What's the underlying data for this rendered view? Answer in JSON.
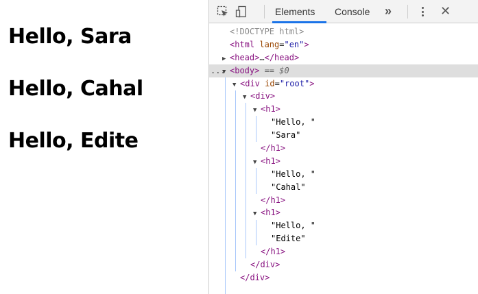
{
  "page": {
    "greetings": [
      "Hello, Sara",
      "Hello, Cahal",
      "Hello, Edite"
    ]
  },
  "devtools": {
    "tabs": [
      {
        "label": "Elements",
        "active": true
      },
      {
        "label": "Console",
        "active": false
      }
    ],
    "more_tabs_glyph": "»",
    "close_glyph": "✕",
    "icons": [
      "inspect-element-icon",
      "device-toolbar-icon",
      "more-options-icon",
      "close-icon"
    ],
    "accent_color": "#1a73e8",
    "tree": [
      {
        "indent": 0,
        "tri": "",
        "tag_open": "<!DOCTYPE html>",
        "kind": "doctype"
      },
      {
        "indent": 0,
        "tri": "",
        "tag_open": "<html",
        "attr": " lang",
        "eq": "=",
        "val": "\"en\"",
        "tag_close": ">"
      },
      {
        "indent": 0,
        "tri": "▶",
        "tag_open": "<head>",
        "mid": "…",
        "tag_close": "</head>"
      },
      {
        "indent": 0,
        "tri": "▼",
        "tag_open": "<body>",
        "meta": " == $0",
        "selected": true,
        "dots": "..."
      },
      {
        "indent": 1,
        "tri": "▼",
        "tag_open": "<div",
        "attr": " id",
        "eq": "=",
        "val": "\"root\"",
        "tag_close": ">"
      },
      {
        "indent": 2,
        "tri": "▼",
        "tag_open": "<div>"
      },
      {
        "indent": 3,
        "tri": "▼",
        "tag_open": "<h1>"
      },
      {
        "indent": 4,
        "tri": "",
        "text": "\"Hello, \""
      },
      {
        "indent": 4,
        "tri": "",
        "text": "\"Sara\""
      },
      {
        "indent": 3,
        "tri": "",
        "tag_open": "</h1>",
        "close_only": true
      },
      {
        "indent": 3,
        "tri": "▼",
        "tag_open": "<h1>"
      },
      {
        "indent": 4,
        "tri": "",
        "text": "\"Hello, \""
      },
      {
        "indent": 4,
        "tri": "",
        "text": "\"Cahal\""
      },
      {
        "indent": 3,
        "tri": "",
        "tag_open": "</h1>",
        "close_only": true
      },
      {
        "indent": 3,
        "tri": "▼",
        "tag_open": "<h1>"
      },
      {
        "indent": 4,
        "tri": "",
        "text": "\"Hello, \""
      },
      {
        "indent": 4,
        "tri": "",
        "text": "\"Edite\""
      },
      {
        "indent": 3,
        "tri": "",
        "tag_open": "</h1>",
        "close_only": true
      },
      {
        "indent": 2,
        "tri": "",
        "tag_open": "</div>",
        "close_only": true
      },
      {
        "indent": 1,
        "tri": "",
        "tag_open": "</div>",
        "close_only": true
      }
    ]
  }
}
